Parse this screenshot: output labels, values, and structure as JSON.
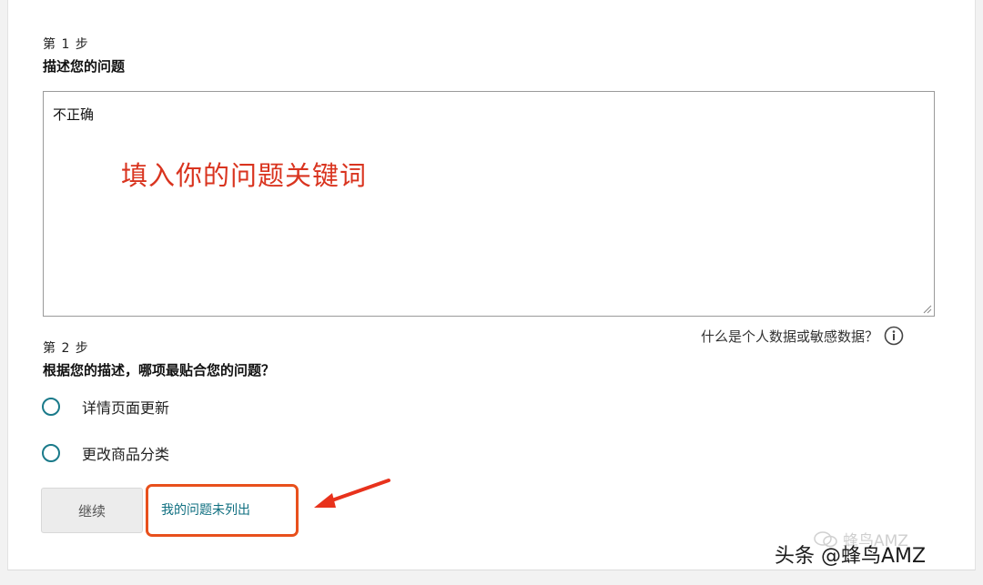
{
  "step1": {
    "number_label": "第 1 步",
    "title": "描述您的问题",
    "textarea_value": "不正确"
  },
  "annotation": {
    "text": "填入你的问题关键词",
    "color": "#d9341f"
  },
  "privacy": {
    "link_text": "什么是个人数据或敏感数据？",
    "icon": "info-icon"
  },
  "step2": {
    "number_label": "第 2 步",
    "title": "根据您的描述，哪项最贴合您的问题？",
    "options": [
      {
        "label": "详情页面更新"
      },
      {
        "label": "更改商品分类"
      }
    ]
  },
  "actions": {
    "continue_label": "继续",
    "not_listed_label": "我的问题未列出"
  },
  "watermark": {
    "faint_text": "蜂鸟AMZ",
    "main_text": "头条 @蜂鸟AMZ"
  },
  "colors": {
    "radio_accent": "#1a7a8a",
    "link": "#0f6f80",
    "highlight": "#e8501c"
  }
}
